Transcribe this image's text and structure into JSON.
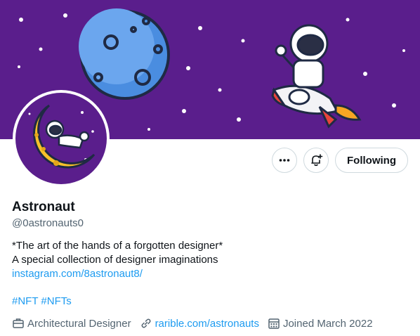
{
  "profile": {
    "name": "Astronaut",
    "handle": "@0astronauts0",
    "bio_line1": "*The art of the hands of a forgotten designer*",
    "bio_line2": "A special collection of designer imaginations",
    "bio_link": "instagram.com/8astronaut8/",
    "tags": [
      "#NFT",
      "#NFTs"
    ]
  },
  "actions": {
    "more_icon": "more-horizontal-icon",
    "notify_icon": "bell-plus-icon",
    "follow_label": "Following"
  },
  "meta": {
    "category_icon": "briefcase-icon",
    "category": "Architectural Designer",
    "link_icon": "link-icon",
    "website": "rarible.com/astronauts",
    "calendar_icon": "calendar-icon",
    "joined": "Joined March 2022"
  },
  "colors": {
    "banner": "#5a1e8c",
    "link": "#1d9bf0",
    "secondary_text": "#536471"
  }
}
